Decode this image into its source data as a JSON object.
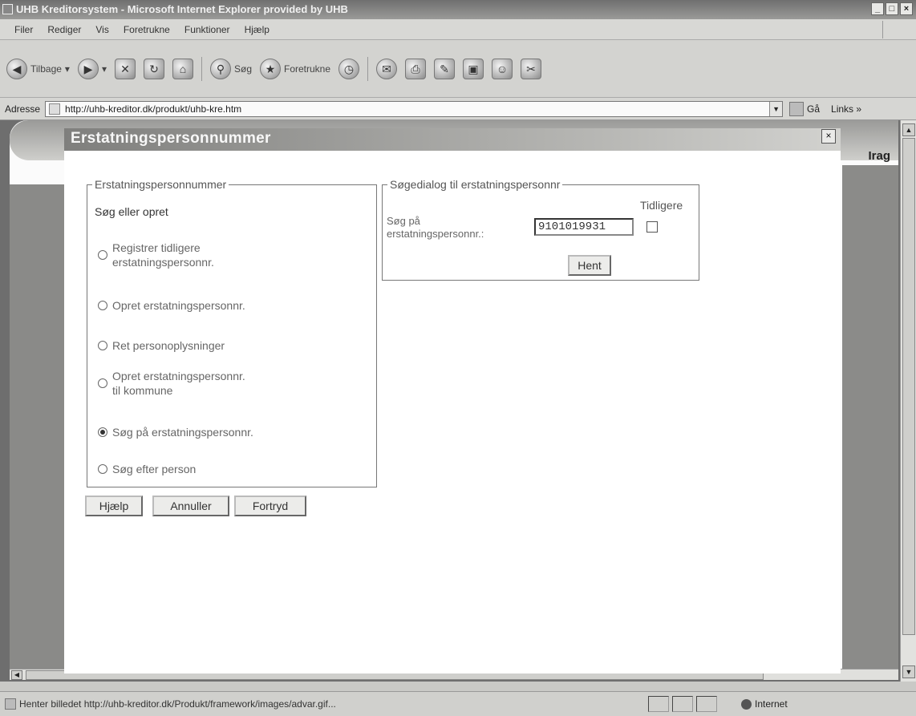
{
  "window": {
    "title": "UHB Kreditorsystem - Microsoft Internet Explorer provided by UHB",
    "controls": [
      "_",
      "□",
      "×"
    ]
  },
  "menu": [
    "Filer",
    "Rediger",
    "Vis",
    "Foretrukne",
    "Funktioner",
    "Hjælp"
  ],
  "toolbar": {
    "back": "Tilbage",
    "search": "Søg",
    "favorites": "Foretrukne"
  },
  "address": {
    "label": "Adresse",
    "url": "http://uhb-kreditor.dk/produkt/uhb-kre.htm",
    "go": "Gå",
    "links": "Links »"
  },
  "page": {
    "brand_fragment": "Irag"
  },
  "dialog": {
    "title": "Erstatningspersonnummer",
    "close": "×",
    "left_group": {
      "legend": "Erstatningspersonnummer",
      "subtitle": "Søg eller opret",
      "options": [
        {
          "label_line1": "Registrer tidligere",
          "label_line2": "erstatningspersonnr.",
          "checked": false
        },
        {
          "label_line1": "Opret erstatningspersonnr.",
          "label_line2": "",
          "checked": false
        },
        {
          "label_line1": "Ret personoplysninger",
          "label_line2": "",
          "checked": false
        },
        {
          "label_line1": "Opret erstatningspersonnr.",
          "label_line2": "til kommune",
          "checked": false
        },
        {
          "label_line1": "Søg på erstatningspersonnr.",
          "label_line2": "",
          "checked": true
        },
        {
          "label_line1": "Søg efter person",
          "label_line2": "",
          "checked": false
        }
      ]
    },
    "right_group": {
      "legend": "Søgedialog til erstatningspersonnr",
      "previous_label": "Tidligere",
      "field_label_line1": "Søg på",
      "field_label_line2": "erstatningspersonnr.:",
      "field_value": "9101019931",
      "fetch_button": "Hent"
    },
    "buttons": {
      "help": "Hjælp",
      "cancel": "Annuller",
      "undo": "Fortryd"
    }
  },
  "status": {
    "text": "Henter billedet http://uhb-kreditor.dk/Produkt/framework/images/advar.gif...",
    "zone": "Internet"
  }
}
